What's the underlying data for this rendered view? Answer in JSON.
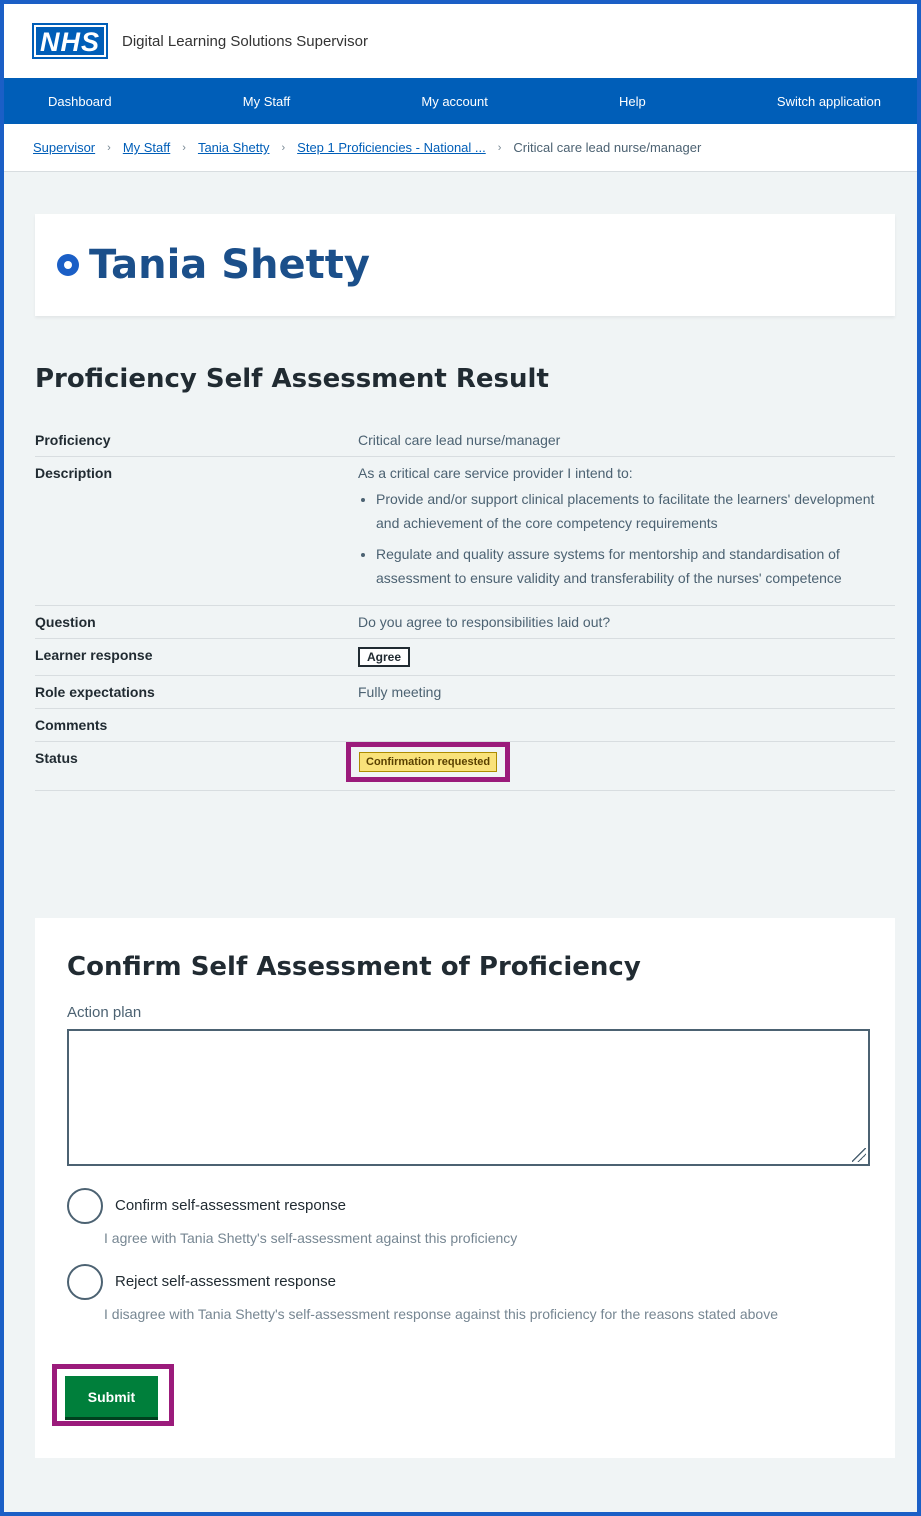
{
  "header": {
    "logo": "NHS",
    "service_name": "Digital Learning Solutions Supervisor"
  },
  "nav": {
    "items": [
      "Dashboard",
      "My Staff",
      "My account",
      "Help",
      "Switch application"
    ]
  },
  "breadcrumb": {
    "links": [
      "Supervisor",
      "My Staff",
      "Tania Shetty",
      "Step 1 Proficiencies - National ..."
    ],
    "current": "Critical care lead nurse/manager"
  },
  "person": {
    "name": "Tania Shetty",
    "icon": "person-circle-icon"
  },
  "result": {
    "title": "Proficiency Self Assessment Result",
    "rows": {
      "proficiency": {
        "key": "Proficiency",
        "value": "Critical care lead nurse/manager"
      },
      "description": {
        "key": "Description",
        "intro": "As a critical care service provider I intend to:",
        "bullets": [
          "Provide and/or support clinical placements to facilitate the learners' development and achievement of the core competency requirements",
          "Regulate and quality assure systems for mentorship and standardisation of assessment to ensure validity and transferability of the nurses' competence"
        ]
      },
      "question": {
        "key": "Question",
        "value": "Do you agree to responsibilities laid out?"
      },
      "learner_response": {
        "key": "Learner response",
        "value": "Agree"
      },
      "role_expectations": {
        "key": "Role expectations",
        "value": "Fully meeting"
      },
      "comments": {
        "key": "Comments",
        "value": ""
      },
      "status": {
        "key": "Status",
        "value": "Confirmation requested"
      }
    }
  },
  "confirm": {
    "title": "Confirm Self Assessment of Proficiency",
    "action_plan_label": "Action plan",
    "action_plan_value": "",
    "options": [
      {
        "label": "Confirm self-assessment response",
        "hint": "I agree with Tania Shetty's self-assessment against this proficiency"
      },
      {
        "label": "Reject self-assessment response",
        "hint": "I disagree with Tania Shetty's self-assessment response against this proficiency for the reasons stated above"
      }
    ],
    "submit_label": "Submit"
  },
  "colors": {
    "nhs_blue": "#005eb8",
    "highlight_magenta": "#9b1b7b",
    "submit_green": "#007f3b",
    "status_yellow": "#f9e27a"
  }
}
